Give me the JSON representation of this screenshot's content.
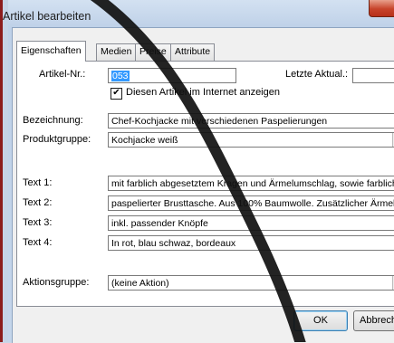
{
  "window": {
    "title": "Artikel bearbeiten"
  },
  "tabs": [
    "Eigenschaften",
    "Medien",
    "Preise",
    "Attribute"
  ],
  "form": {
    "artikel_nr_label": "Artikel-Nr.:",
    "artikel_nr_value": "053",
    "letzte_aktual_label": "Letzte Aktual.:",
    "letzte_aktual_value": "",
    "internet_checkbox_label": "Diesen Artikel im Internet anzeigen",
    "internet_checkbox_checked": true,
    "bezeichnung_label": "Bezeichnung:",
    "bezeichnung_value": "Chef-Kochjacke mit verschiedenen Paspelierungen",
    "produktgruppe_label": "Produktgruppe:",
    "produktgruppe_value": "Kochjacke weiß",
    "text1_label": "Text 1:",
    "text1_value": "mit farblich abgesetztem Kragen und Ärmelumschlag, sowie farbliche",
    "text2_label": "Text 2:",
    "text2_value": "paspelierter Brusttasche. Aus 100% Baumwolle. Zusätzlicher Ärmeltasche",
    "text3_label": "Text 3:",
    "text3_value": "inkl. passender Knöpfe",
    "text4_label": "Text 4:",
    "text4_value": "In rot, blau schwaz, bordeaux",
    "aktionsgruppe_label": "Aktionsgruppe:",
    "aktionsgruppe_value": "(keine Aktion)"
  },
  "buttons": {
    "ok": "OK",
    "cancel": "Abbrech"
  },
  "icons": {
    "close": "close-icon",
    "checkbox": "checkmark-icon",
    "dropdown": "chevron-down-icon"
  },
  "colors": {
    "selection": "#3399ff",
    "close_button": "#c7432a"
  }
}
